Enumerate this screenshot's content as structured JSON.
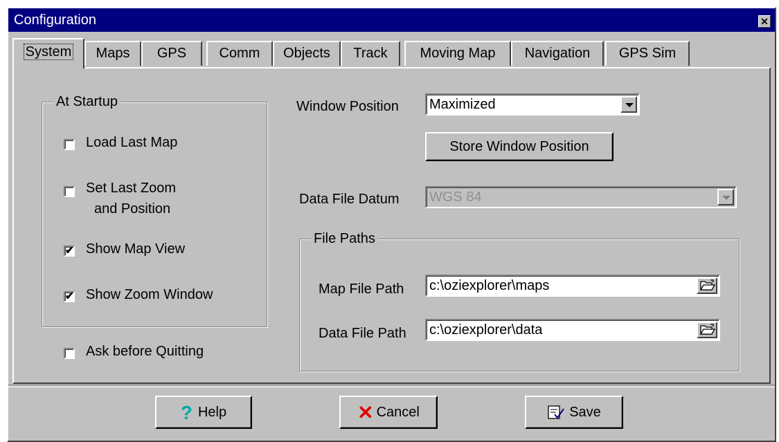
{
  "window": {
    "title": "Configuration",
    "close_glyph": "✕"
  },
  "tabs": [
    {
      "label": "System",
      "active": true
    },
    {
      "label": "Maps"
    },
    {
      "label": "GPS"
    },
    {
      "label": "Comm"
    },
    {
      "label": "Objects"
    },
    {
      "label": "Track"
    },
    {
      "label": "Moving Map"
    },
    {
      "label": "Navigation"
    },
    {
      "label": "GPS Sim"
    }
  ],
  "startup": {
    "legend": "At Startup",
    "load_last_map": {
      "label": "Load Last Map",
      "checked": false
    },
    "set_last_zoom": {
      "label_line1": "Set Last Zoom",
      "label_line2": "and Position",
      "checked": false
    },
    "show_map_view": {
      "label": "Show Map View",
      "checked": true
    },
    "show_zoom_window": {
      "label": "Show Zoom Window",
      "checked": true
    }
  },
  "ask_before_quitting": {
    "label": "Ask before Quitting",
    "checked": false
  },
  "window_position": {
    "label": "Window Position",
    "value": "Maximized",
    "store_button": "Store Window Position"
  },
  "datum": {
    "label": "Data File Datum",
    "value": "WGS 84",
    "disabled": true
  },
  "file_paths": {
    "legend": "File Paths",
    "map": {
      "label": "Map File Path",
      "value": "c:\\oziexplorer\\maps"
    },
    "data": {
      "label": "Data File Path",
      "value": "c:\\oziexplorer\\data"
    }
  },
  "buttons": {
    "help": "Help",
    "cancel": "Cancel",
    "save": "Save"
  },
  "check_glyph": "✔",
  "icons": {
    "help": "question-mark-icon",
    "cancel": "red-x-icon",
    "save": "save-check-icon",
    "folder": "open-folder-icon"
  },
  "colors": {
    "titlebar": "#000080",
    "face": "#c0c0c0",
    "help_icon": "#00a8a8",
    "cancel_icon": "#e00000"
  }
}
